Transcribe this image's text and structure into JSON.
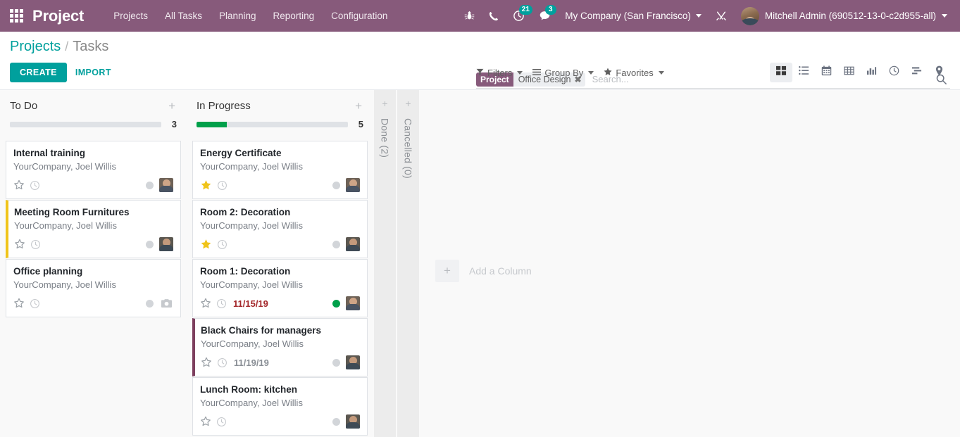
{
  "navbar": {
    "apps_icon": "apps-grid-icon",
    "brand": "Project",
    "menu": [
      {
        "label": "Projects"
      },
      {
        "label": "All Tasks"
      },
      {
        "label": "Planning"
      },
      {
        "label": "Reporting"
      },
      {
        "label": "Configuration"
      }
    ],
    "icons": [
      {
        "name": "bug-icon",
        "badge": null
      },
      {
        "name": "phone-icon",
        "badge": null
      },
      {
        "name": "activity-clock-icon",
        "badge": "21"
      },
      {
        "name": "messages-icon",
        "badge": "3"
      }
    ],
    "company": "My Company (San Francisco)",
    "debug_icon": "wrench-tools-icon",
    "user": "Mitchell Admin (690512-13-0-c2d955-all)"
  },
  "breadcrumb": {
    "root": "Projects",
    "separator": "/",
    "current": "Tasks"
  },
  "buttons": {
    "create": "CREATE",
    "import": "IMPORT"
  },
  "search": {
    "facet_label": "Project",
    "facet_value": "Office Design",
    "facet_remove": "✖",
    "placeholder": "Search...",
    "value": "",
    "search_icon": "magnifier-icon"
  },
  "filters": [
    {
      "label": "Filters",
      "icon": "funnel-icon"
    },
    {
      "label": "Group By",
      "icon": "list-lines-icon"
    },
    {
      "label": "Favorites",
      "icon": "star-icon"
    }
  ],
  "views": [
    {
      "name": "kanban-view",
      "icon": "kanban-icon",
      "active": true
    },
    {
      "name": "list-view",
      "icon": "list-icon",
      "active": false
    },
    {
      "name": "calendar-view",
      "icon": "calendar-icon",
      "active": false
    },
    {
      "name": "pivot-view",
      "icon": "pivot-table-icon",
      "active": false
    },
    {
      "name": "graph-view",
      "icon": "bar-chart-icon",
      "active": false
    },
    {
      "name": "activity-view",
      "icon": "clock-icon",
      "active": false
    },
    {
      "name": "gantt-view",
      "icon": "gantt-icon",
      "active": false
    },
    {
      "name": "map-view",
      "icon": "map-pin-icon",
      "active": false
    }
  ],
  "columns": [
    {
      "title": "To Do",
      "count": "3",
      "progress_percent": 0,
      "add_icon": "plus-icon",
      "cards": [
        {
          "title": "Internal training",
          "subtitle": "YourCompany, Joel Willis",
          "accent": "none",
          "starred": false,
          "date": "",
          "date_state": "none",
          "dot": "gray",
          "avatar": "photo"
        },
        {
          "title": "Meeting Room Furnitures",
          "subtitle": "YourCompany, Joel Willis",
          "accent": "yellow",
          "starred": false,
          "date": "",
          "date_state": "none",
          "dot": "gray",
          "avatar": "photo"
        },
        {
          "title": "Office planning",
          "subtitle": "YourCompany, Joel Willis",
          "accent": "none",
          "starred": false,
          "date": "",
          "date_state": "none",
          "dot": "gray",
          "avatar": "placeholder"
        }
      ]
    },
    {
      "title": "In Progress",
      "count": "5",
      "progress_percent": 20,
      "add_icon": "plus-icon",
      "cards": [
        {
          "title": "Energy Certificate",
          "subtitle": "YourCompany, Joel Willis",
          "accent": "none",
          "starred": true,
          "date": "",
          "date_state": "none",
          "dot": "gray",
          "avatar": "photo"
        },
        {
          "title": "Room 2: Decoration",
          "subtitle": "YourCompany, Joel Willis",
          "accent": "none",
          "starred": true,
          "date": "",
          "date_state": "none",
          "dot": "gray",
          "avatar": "photo"
        },
        {
          "title": "Room 1: Decoration",
          "subtitle": "YourCompany, Joel Willis",
          "accent": "none",
          "starred": false,
          "date": "11/15/19",
          "date_state": "overdue",
          "dot": "green",
          "avatar": "photo"
        },
        {
          "title": "Black Chairs for managers",
          "subtitle": "YourCompany, Joel Willis",
          "accent": "purple",
          "starred": false,
          "date": "11/19/19",
          "date_state": "normal",
          "dot": "gray",
          "avatar": "photo"
        },
        {
          "title": "Lunch Room: kitchen",
          "subtitle": "YourCompany, Joel Willis",
          "accent": "none",
          "starred": false,
          "date": "",
          "date_state": "none",
          "dot": "gray",
          "avatar": "photo"
        }
      ]
    }
  ],
  "folded_columns": [
    {
      "title": "Done (2)",
      "add_icon": "plus-icon"
    },
    {
      "title": "Cancelled (0)",
      "add_icon": "plus-icon"
    }
  ],
  "add_column": {
    "icon": "plus-icon",
    "label": "Add a Column"
  },
  "colors": {
    "brand_purple": "#875a7b",
    "teal": "#00a09d",
    "green": "#00a04a",
    "overdue_red": "#a4282b",
    "star_yellow": "#f0c419",
    "accent_yellow": "#f0c419",
    "accent_purple": "#7d3f5e"
  }
}
